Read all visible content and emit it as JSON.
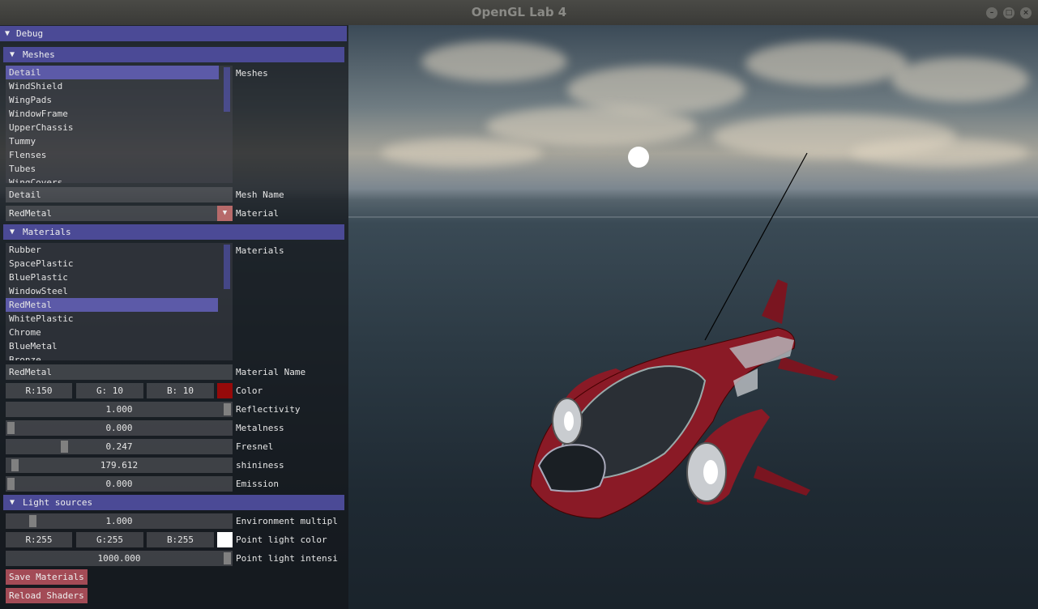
{
  "window": {
    "title": "OpenGL Lab 4",
    "controls": [
      "–",
      "□",
      "×"
    ]
  },
  "gui": {
    "debug_header": "Debug",
    "collapse_glyph": "▼",
    "meshes": {
      "header": "Meshes",
      "list_label": "Meshes",
      "items": [
        "Detail",
        "WindShield",
        "WingPads",
        "WindowFrame",
        "UpperChassis",
        "Tummy",
        "Flenses",
        "Tubes",
        "WingCovers"
      ],
      "selected_index": 0,
      "mesh_name_value": "Detail",
      "mesh_name_label": "Mesh Name",
      "material_value": "RedMetal",
      "material_label": "Material",
      "dropdown_glyph": "▼"
    },
    "materials": {
      "header": "Materials",
      "list_label": "Materials",
      "items": [
        "Rubber",
        "SpacePlastic",
        "BluePlastic",
        "WindowSteel",
        "RedMetal",
        "WhitePlastic",
        "Chrome",
        "BlueMetal",
        "Bronze"
      ],
      "selected_index": 4,
      "material_name_value": "RedMetal",
      "material_name_label": "Material Name",
      "color": {
        "r": "R:150",
        "g": "G: 10",
        "b": "B: 10",
        "label": "Color",
        "swatch": "#960a0a"
      },
      "reflectivity": {
        "value": "1.000",
        "label": "Reflectivity",
        "fraction": 1.0
      },
      "metalness": {
        "value": "0.000",
        "label": "Metalness",
        "fraction": 0.0
      },
      "fresnel": {
        "value": "0.247",
        "label": "Fresnel",
        "fraction": 0.247
      },
      "shininess": {
        "value": "179.612",
        "label": "shininess",
        "fraction": 0.018
      },
      "emission": {
        "value": "0.000",
        "label": "Emission",
        "fraction": 0.0
      }
    },
    "light_sources": {
      "header": "Light sources",
      "environment": {
        "value": "1.000",
        "label": "Environment multipl",
        "fraction": 0.1
      },
      "point_color": {
        "r": "R:255",
        "g": "G:255",
        "b": "B:255",
        "label": "Point light color",
        "swatch": "#ffffff"
      },
      "point_intensity": {
        "value": "1000.000",
        "label": "Point light intensi",
        "fraction": 1.0
      }
    },
    "buttons": {
      "save": "Save Materials",
      "reload": "Reload Shaders"
    }
  },
  "colors": {
    "header": "#4b4a96",
    "selection": "#5c5aa8",
    "button": "#a34b56",
    "ship_red": "#7a1520"
  }
}
